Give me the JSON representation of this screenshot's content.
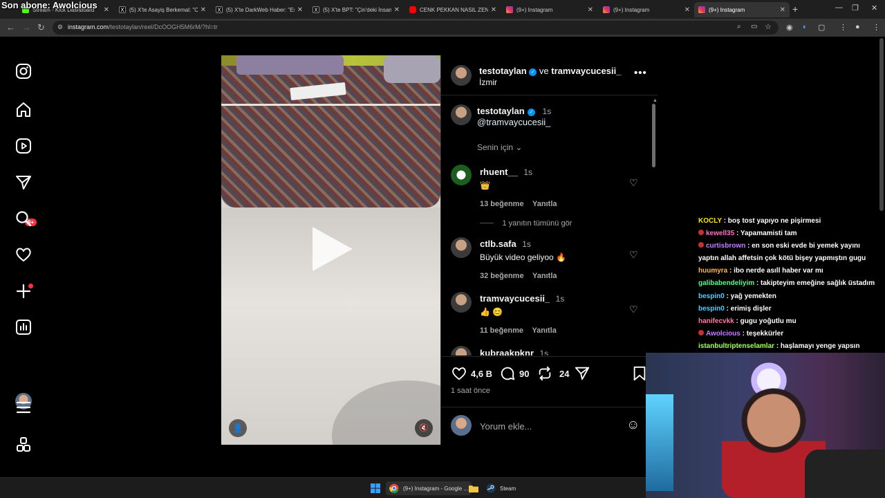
{
  "overlay": {
    "subscriber_text": "Son abone: Awolcious"
  },
  "browser": {
    "tabs": [
      {
        "label": "Stream - Kick Dashboard",
        "favicon": "kick-icon",
        "color": "#53fc18"
      },
      {
        "label": "(5) X'te Asayiş Berkemal: \"Ci...",
        "favicon": "x-icon",
        "color": "#ffffff"
      },
      {
        "label": "(5) X'te DarkWeb Haber: \"Es...",
        "favicon": "x-icon",
        "color": "#ffffff"
      },
      {
        "label": "(5) X'te BPT: \"Çin'deki İnsan...",
        "favicon": "x-icon",
        "color": "#ffffff"
      },
      {
        "label": "CENK PEKKAN NASIL ZENGİ...",
        "favicon": "youtube-icon",
        "color": "#ff0000"
      },
      {
        "label": "(9+) Instagram",
        "favicon": "instagram-icon",
        "color": "#e1306c"
      },
      {
        "label": "(9+) Instagram",
        "favicon": "instagram-icon",
        "color": "#e1306c"
      },
      {
        "label": "(9+) Instagram",
        "favicon": "instagram-icon",
        "color": "#e1306c"
      }
    ],
    "url_domain": "instagram.com",
    "url_path": "/testotaylan/reel/DcOOGH5M6rM/?hl=tr"
  },
  "post": {
    "header_user": "testotaylan",
    "header_joiner": "ve",
    "header_collab": "tramvaycucesii_",
    "location": "İzmir",
    "caption_user": "testotaylan",
    "caption_time": "1s",
    "caption_mention": "@tramvaycucesii_",
    "sort_label": "Senin için",
    "comments": [
      {
        "user": "rhuent__",
        "time": "1s",
        "text": "👑",
        "likes": "13 beğenme",
        "reply": "Yanıtla"
      },
      {
        "user": "ctlb.safa",
        "time": "1s",
        "text": "Büyük video geliyoo 🔥",
        "likes": "32 beğenme",
        "reply": "Yanıtla"
      },
      {
        "user": "tramvaycucesii_",
        "time": "1s",
        "text": "👍 😊",
        "likes": "11 beğenme",
        "reply": "Yanıtla"
      },
      {
        "user": "kubraakpknr",
        "time": "1s"
      }
    ],
    "view_replies": "1 yanıtın tümünü gör",
    "like_count": "4,6 B",
    "comment_count": "90",
    "repost_count": "24",
    "posted_ago": "1 saat önce",
    "add_comment_placeholder": "Yorum ekle..."
  },
  "chat": [
    {
      "user": "KOCLY",
      "color": "#ffe600",
      "text": ": boş tost yapıyo ne pişirmesi",
      "mod": false
    },
    {
      "user": "kewell35",
      "color": "#ff6ec7",
      "text": ": Yapamamisti tam",
      "mod": true
    },
    {
      "user": "curtisbrown",
      "color": "#c77dff",
      "text": ": en son eski evde bi yemek yayını",
      "mod": true
    },
    {
      "user": "",
      "color": "#ffffff",
      "text": "yaptın allah affetsin çok kötü bişey yapmıştın gugu",
      "mod": false
    },
    {
      "user": "huumyra",
      "color": "#ffb84d",
      "text": ": ibo nerde asıll haber var mı",
      "mod": false
    },
    {
      "user": "galibabendeliyim",
      "color": "#4dff88",
      "text": ": takipteyim emeğine sağlık üstadım",
      "mod": false
    },
    {
      "user": "bespin0",
      "color": "#4dd2ff",
      "text": ": yağ yemekten",
      "mod": false
    },
    {
      "user": "bespin0",
      "color": "#4dd2ff",
      "text": ": erimiş dişler",
      "mod": false
    },
    {
      "user": "hanifecvkk",
      "color": "#ff7aa8",
      "text": ": gugu yoğutlu mu",
      "mod": false
    },
    {
      "user": "Awolcious",
      "color": "#c77dff",
      "text": ": teşekkürler",
      "mod": true
    },
    {
      "user": "istanbultriptenselamlar",
      "color": "#a6ff4d",
      "text": ": haşlamayı yenge yapsın",
      "mod": false
    }
  ],
  "sidebar": {
    "notification_badge": "9+"
  },
  "taskbar": {
    "chrome_label": "(9+) Instagram - Google ...",
    "steam_label": "Steam"
  },
  "colors": {
    "accent": "#0095f6",
    "badge": "#ff3040"
  }
}
